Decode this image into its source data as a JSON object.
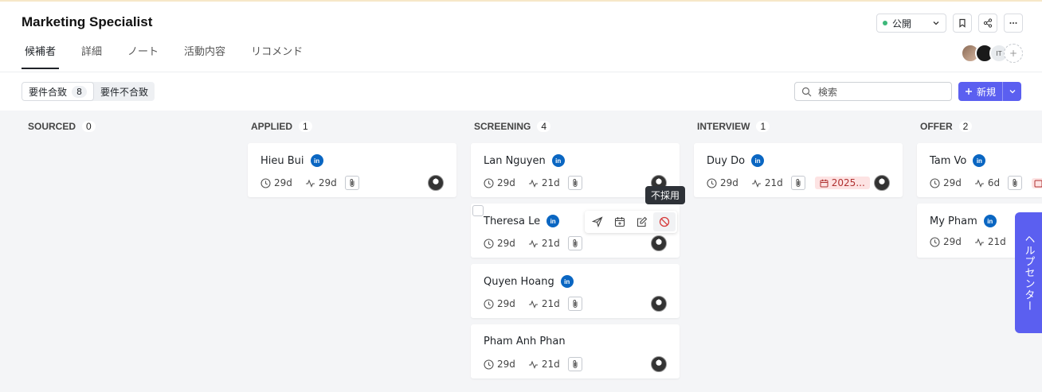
{
  "header": {
    "title": "Marketing Specialist",
    "tabs": [
      {
        "label": "候補者"
      },
      {
        "label": "詳細"
      },
      {
        "label": "ノート"
      },
      {
        "label": "活動内容"
      },
      {
        "label": "リコメンド"
      }
    ],
    "visibility": "公開",
    "avatars_more": "+",
    "avatar_initials": "IT"
  },
  "toolbar": {
    "filter_match_label": "要件合致",
    "filter_match_count": "8",
    "filter_mismatch_label": "要件不合致",
    "search_placeholder": "検索",
    "new_label": "新規"
  },
  "columns": [
    {
      "name": "SOURCED",
      "count": "0",
      "cards": []
    },
    {
      "name": "APPLIED",
      "count": "1",
      "cards": [
        {
          "name": "Hieu Bui",
          "t1": "29d",
          "t2": "29d"
        }
      ]
    },
    {
      "name": "SCREENING",
      "count": "4",
      "cards": [
        {
          "name": "Lan Nguyen",
          "t1": "29d",
          "t2": "21d"
        },
        {
          "name": "Theresa Le",
          "t1": "29d",
          "t2": "21d"
        },
        {
          "name": "Quyen Hoang",
          "t1": "29d",
          "t2": "21d"
        },
        {
          "name": "Pham Anh Phan",
          "t1": "29d",
          "t2": "21d"
        }
      ]
    },
    {
      "name": "INTERVIEW",
      "count": "1",
      "cards": [
        {
          "name": "Duy Do",
          "t1": "29d",
          "t2": "21d",
          "date": "2025..."
        }
      ]
    },
    {
      "name": "OFFER",
      "count": "2",
      "cards": [
        {
          "name": "Tam Vo",
          "t1": "29d",
          "t2": "6d"
        },
        {
          "name": "My Pham",
          "t1": "29d",
          "t2": "21d"
        }
      ]
    }
  ],
  "linkedin_label": "in",
  "tooltip": "不採用",
  "help_center": "ヘルプセンター"
}
